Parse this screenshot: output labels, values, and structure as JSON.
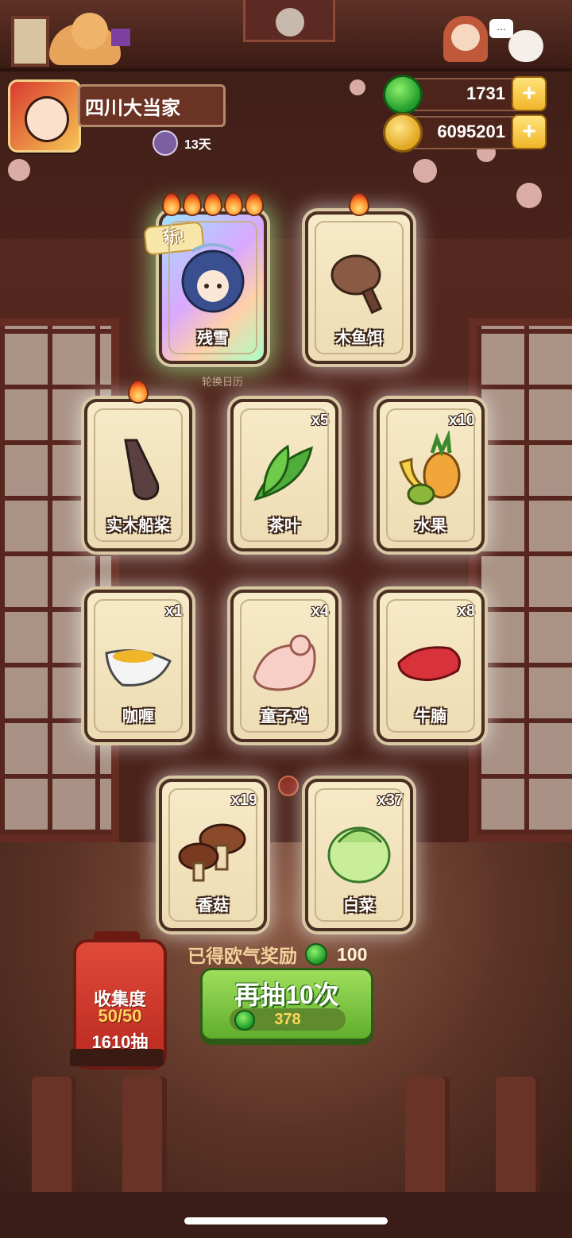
{
  "header": {
    "player_name": "四川大当家",
    "days": "13天",
    "jade_amount": "1731",
    "coin_amount": "6095201",
    "plus_label": "+",
    "bubble": "..."
  },
  "calendar_label": "轮换日历",
  "new_tag": "新!",
  "cards": [
    {
      "name": "残雪",
      "count": "",
      "flames": 5,
      "is_new": true,
      "icon": "ghost-chef-icon"
    },
    {
      "name": "木鱼饵",
      "count": "",
      "flames": 1,
      "icon": "meat-bait-icon"
    },
    {
      "name": "实木船桨",
      "count": "",
      "flames": 1,
      "icon": "oar-icon"
    },
    {
      "name": "茶叶",
      "count": "x5",
      "icon": "tea-leaf-icon"
    },
    {
      "name": "水果",
      "count": "x10",
      "icon": "fruit-icon"
    },
    {
      "name": "咖喱",
      "count": "x1",
      "icon": "curry-icon"
    },
    {
      "name": "童子鸡",
      "count": "x4",
      "icon": "chicken-icon"
    },
    {
      "name": "牛腩",
      "count": "x8",
      "icon": "beef-icon"
    },
    {
      "name": "香菇",
      "count": "x19",
      "icon": "mushroom-icon"
    },
    {
      "name": "白菜",
      "count": "x37",
      "icon": "cabbage-icon"
    }
  ],
  "reward": {
    "label": "已得欧气奖励",
    "amount": "100"
  },
  "collection": {
    "title": "收集度",
    "progress": "50/50",
    "draws": "1610抽"
  },
  "draw_button": {
    "label": "再抽10次",
    "cost": "378"
  },
  "colors": {
    "draw_button": "#7cc544",
    "lantern": "#d43a2c",
    "jade": "#2ab53a",
    "coin": "#f0b62a"
  }
}
